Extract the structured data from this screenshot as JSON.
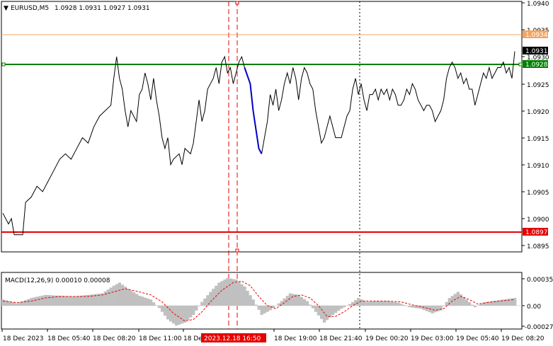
{
  "window": {
    "symbol_label": "EURUSD,M5",
    "ohlc_label": "1.0928 1.0931 1.0927 1.0931",
    "menu_glyph": "▼"
  },
  "macd": {
    "label": "MACD(12,26,9) 0.00010 0.00008",
    "ticks": [
      "0.00035",
      "0.00",
      "-0.00027"
    ]
  },
  "price_axis": {
    "ticks": [
      "1.0940",
      "1.0935",
      "1.0930",
      "1.0925",
      "1.0920",
      "1.0915",
      "1.0910",
      "1.0905",
      "1.0900",
      "1.0895"
    ]
  },
  "levels": {
    "upper_tag": "1.0934",
    "current_tag": "1.0931",
    "green_tag": "1.0928",
    "red_tag": "1.0897"
  },
  "time_axis": {
    "labels": [
      "18 Dec 2023",
      "18 Dec 05:40",
      "18 Dec 08:20",
      "18 Dec 11:00",
      "18 Dec",
      "18 Dec 19:00",
      "18 Dec 21:40",
      "19 Dec 00:20",
      "19 Dec 03:00",
      "19 Dec 05:40",
      "19 Dec 08:20"
    ],
    "highlight": "2023.12.18 16:50"
  },
  "colors": {
    "price_line": "#000000",
    "signal_segment": "#0000c8",
    "green_level": "#008000",
    "red_level": "#e60000",
    "upper_level": "#f4a460",
    "macd_hist": "#c0c0c0",
    "macd_signal": "#e60000",
    "highlight_bg": "#e60000"
  },
  "chart_data": [
    {
      "type": "line",
      "title": "EURUSD,M5",
      "ylim": [
        1.0892,
        1.0941
      ],
      "horizontal_levels": [
        1.0934,
        1.0928,
        1.0897
      ],
      "current_price": 1.0931,
      "points": [
        [
          0,
          1.0901
        ],
        [
          2,
          1.0899
        ],
        [
          3,
          1.09
        ],
        [
          4,
          1.0897
        ],
        [
          7,
          1.0897
        ],
        [
          8,
          1.0903
        ],
        [
          10,
          1.0904
        ],
        [
          12,
          1.0906
        ],
        [
          14,
          1.0905
        ],
        [
          16,
          1.0907
        ],
        [
          18,
          1.0909
        ],
        [
          20,
          1.0911
        ],
        [
          22,
          1.0912
        ],
        [
          24,
          1.0911
        ],
        [
          26,
          1.0913
        ],
        [
          28,
          1.0915
        ],
        [
          30,
          1.0914
        ],
        [
          32,
          1.0917
        ],
        [
          34,
          1.0919
        ],
        [
          36,
          1.092
        ],
        [
          38,
          1.0921
        ],
        [
          39,
          1.0926
        ],
        [
          40,
          1.093
        ],
        [
          41,
          1.0926
        ],
        [
          42,
          1.0924
        ],
        [
          43,
          1.092
        ],
        [
          44,
          1.0917
        ],
        [
          45,
          1.092
        ],
        [
          47,
          1.0918
        ],
        [
          48,
          1.0923
        ],
        [
          49,
          1.0924
        ],
        [
          50,
          1.0927
        ],
        [
          51,
          1.0925
        ],
        [
          52,
          1.0922
        ],
        [
          53,
          1.0926
        ],
        [
          54,
          1.0922
        ],
        [
          55,
          1.0919
        ],
        [
          56,
          1.0915
        ],
        [
          57,
          1.0913
        ],
        [
          58,
          1.0915
        ],
        [
          59,
          1.091
        ],
        [
          60,
          1.0911
        ],
        [
          62,
          1.0912
        ],
        [
          63,
          1.091
        ],
        [
          64,
          1.0913
        ],
        [
          66,
          1.0912
        ],
        [
          67,
          1.0914
        ],
        [
          68,
          1.0918
        ],
        [
          69,
          1.0922
        ],
        [
          70,
          1.0918
        ],
        [
          71,
          1.092
        ],
        [
          72,
          1.0924
        ],
        [
          73,
          1.0925
        ],
        [
          74,
          1.0926
        ],
        [
          75,
          1.0928
        ],
        [
          76,
          1.0925
        ],
        [
          77,
          1.0929
        ],
        [
          78,
          1.093
        ],
        [
          79,
          1.0927
        ],
        [
          80,
          1.0928
        ],
        [
          81,
          1.0925
        ],
        [
          82,
          1.0927
        ],
        [
          83,
          1.0929
        ],
        [
          84,
          1.093
        ],
        [
          85,
          1.0928
        ]
      ],
      "signal_points": [
        [
          85,
          1.0928
        ],
        [
          87,
          1.0925
        ],
        [
          88,
          1.092
        ],
        [
          90,
          1.0913
        ],
        [
          91,
          1.0912
        ]
      ],
      "points_after": [
        [
          91,
          1.0912
        ],
        [
          92,
          1.0915
        ],
        [
          93,
          1.0918
        ],
        [
          94,
          1.0923
        ],
        [
          95,
          1.0921
        ],
        [
          96,
          1.0924
        ],
        [
          97,
          1.092
        ],
        [
          98,
          1.0922
        ],
        [
          99,
          1.0925
        ],
        [
          100,
          1.0927
        ],
        [
          101,
          1.0925
        ],
        [
          102,
          1.0928
        ],
        [
          103,
          1.0926
        ],
        [
          104,
          1.0922
        ],
        [
          105,
          1.0926
        ],
        [
          106,
          1.0928
        ],
        [
          107,
          1.0927
        ],
        [
          108,
          1.0925
        ],
        [
          109,
          1.0924
        ],
        [
          110,
          1.092
        ],
        [
          111,
          1.0917
        ],
        [
          112,
          1.0914
        ],
        [
          113,
          1.0915
        ],
        [
          114,
          1.0917
        ],
        [
          115,
          1.0919
        ],
        [
          116,
          1.0917
        ],
        [
          117,
          1.0915
        ],
        [
          118,
          1.0915
        ],
        [
          119,
          1.0915
        ],
        [
          120,
          1.0917
        ],
        [
          121,
          1.0919
        ],
        [
          122,
          1.092
        ],
        [
          123,
          1.0924
        ],
        [
          124,
          1.0926
        ],
        [
          125,
          1.0923
        ],
        [
          126,
          1.0925
        ],
        [
          127,
          1.0922
        ],
        [
          128,
          1.092
        ],
        [
          129,
          1.0923
        ],
        [
          130,
          1.0923
        ],
        [
          131,
          1.0924
        ],
        [
          132,
          1.0922
        ],
        [
          133,
          1.0924
        ],
        [
          134,
          1.0923
        ],
        [
          135,
          1.0924
        ],
        [
          136,
          1.0922
        ],
        [
          137,
          1.0924
        ],
        [
          138,
          1.0923
        ],
        [
          139,
          1.0921
        ],
        [
          140,
          1.0921
        ],
        [
          141,
          1.0922
        ],
        [
          142,
          1.0924
        ],
        [
          143,
          1.0923
        ],
        [
          144,
          1.0925
        ],
        [
          145,
          1.0924
        ],
        [
          146,
          1.0922
        ],
        [
          147,
          1.0921
        ],
        [
          148,
          1.092
        ],
        [
          149,
          1.0921
        ],
        [
          150,
          1.0921
        ],
        [
          151,
          1.092
        ],
        [
          152,
          1.0918
        ],
        [
          153,
          1.0919
        ],
        [
          154,
          1.092
        ],
        [
          155,
          1.0922
        ],
        [
          156,
          1.0926
        ],
        [
          157,
          1.0928
        ],
        [
          158,
          1.0929
        ],
        [
          159,
          1.0928
        ],
        [
          160,
          1.0926
        ],
        [
          161,
          1.0927
        ],
        [
          162,
          1.0925
        ],
        [
          163,
          1.0926
        ],
        [
          164,
          1.0924
        ],
        [
          165,
          1.0924
        ],
        [
          166,
          1.0921
        ],
        [
          167,
          1.0923
        ],
        [
          168,
          1.0925
        ],
        [
          169,
          1.0927
        ],
        [
          170,
          1.0926
        ],
        [
          171,
          1.0928
        ],
        [
          172,
          1.0926
        ],
        [
          173,
          1.0927
        ],
        [
          174,
          1.0928
        ],
        [
          175,
          1.0928
        ],
        [
          176,
          1.0929
        ],
        [
          177,
          1.0927
        ],
        [
          178,
          1.0928
        ],
        [
          179,
          1.0926
        ],
        [
          180,
          1.0931
        ]
      ]
    },
    {
      "type": "bar",
      "title": "MACD(12,26,9) 0.00010 0.00008",
      "ylim": [
        -0.00028,
        0.0004
      ],
      "histogram": [
        [
          0,
          8e-05
        ],
        [
          5,
          3e-05
        ],
        [
          10,
          0.0001
        ],
        [
          15,
          0.00014
        ],
        [
          20,
          0.00013
        ],
        [
          25,
          0.00012
        ],
        [
          30,
          0.00014
        ],
        [
          35,
          0.00016
        ],
        [
          39,
          0.00026
        ],
        [
          41,
          0.0003
        ],
        [
          44,
          0.00022
        ],
        [
          48,
          0.00013
        ],
        [
          52,
          8e-05
        ],
        [
          55,
          -3e-05
        ],
        [
          58,
          -0.00018
        ],
        [
          61,
          -0.00026
        ],
        [
          64,
          -0.00022
        ],
        [
          67,
          -0.00012
        ],
        [
          70,
          5e-05
        ],
        [
          73,
          0.00018
        ],
        [
          76,
          0.0003
        ],
        [
          79,
          0.00036
        ],
        [
          82,
          0.00034
        ],
        [
          85,
          0.00025
        ],
        [
          88,
          8e-05
        ],
        [
          91,
          -0.00012
        ],
        [
          94,
          -6e-05
        ],
        [
          98,
          6e-05
        ],
        [
          101,
          0.00016
        ],
        [
          104,
          0.00014
        ],
        [
          107,
          6e-05
        ],
        [
          110,
          -8e-05
        ],
        [
          113,
          -0.00022
        ],
        [
          116,
          -0.00012
        ],
        [
          119,
          -4e-05
        ],
        [
          122,
          2e-05
        ],
        [
          125,
          0.0001
        ],
        [
          128,
          5e-05
        ],
        [
          131,
          6e-05
        ],
        [
          135,
          6e-05
        ],
        [
          139,
          4e-05
        ],
        [
          143,
          -2e-05
        ],
        [
          147,
          -4e-05
        ],
        [
          151,
          -0.0001
        ],
        [
          154,
          -6e-05
        ],
        [
          157,
          0.0001
        ],
        [
          160,
          0.00018
        ],
        [
          163,
          8e-05
        ],
        [
          166,
          -2e-05
        ],
        [
          169,
          4e-05
        ],
        [
          172,
          6e-05
        ],
        [
          176,
          8e-05
        ],
        [
          180,
          0.0001
        ]
      ],
      "signal": [
        [
          0,
          6e-05
        ],
        [
          5,
          4e-05
        ],
        [
          10,
          6e-05
        ],
        [
          15,
          0.0001
        ],
        [
          20,
          0.00012
        ],
        [
          25,
          0.00012
        ],
        [
          30,
          0.00012
        ],
        [
          35,
          0.00014
        ],
        [
          39,
          0.00018
        ],
        [
          43,
          0.00022
        ],
        [
          48,
          0.00018
        ],
        [
          52,
          0.00014
        ],
        [
          56,
          5e-05
        ],
        [
          60,
          -0.0001
        ],
        [
          64,
          -0.0002
        ],
        [
          67,
          -0.00018
        ],
        [
          70,
          -8e-05
        ],
        [
          73,
          5e-05
        ],
        [
          77,
          0.0002
        ],
        [
          81,
          0.0003
        ],
        [
          84,
          0.00032
        ],
        [
          87,
          0.00026
        ],
        [
          90,
          0.00012
        ],
        [
          93,
          0.0
        ],
        [
          96,
          -4e-05
        ],
        [
          99,
          4e-05
        ],
        [
          102,
          0.00012
        ],
        [
          105,
          0.00014
        ],
        [
          108,
          0.0001
        ],
        [
          111,
          0.0
        ],
        [
          114,
          -0.00014
        ],
        [
          117,
          -0.00014
        ],
        [
          120,
          -8e-05
        ],
        [
          123,
          0.0
        ],
        [
          126,
          6e-05
        ],
        [
          130,
          6e-05
        ],
        [
          135,
          6e-05
        ],
        [
          140,
          5e-05
        ],
        [
          144,
          1e-05
        ],
        [
          148,
          -2e-05
        ],
        [
          152,
          -6e-05
        ],
        [
          155,
          -4e-05
        ],
        [
          158,
          6e-05
        ],
        [
          161,
          0.00012
        ],
        [
          164,
          8e-05
        ],
        [
          167,
          2e-05
        ],
        [
          170,
          4e-05
        ],
        [
          175,
          6e-05
        ],
        [
          180,
          8e-05
        ]
      ]
    }
  ]
}
